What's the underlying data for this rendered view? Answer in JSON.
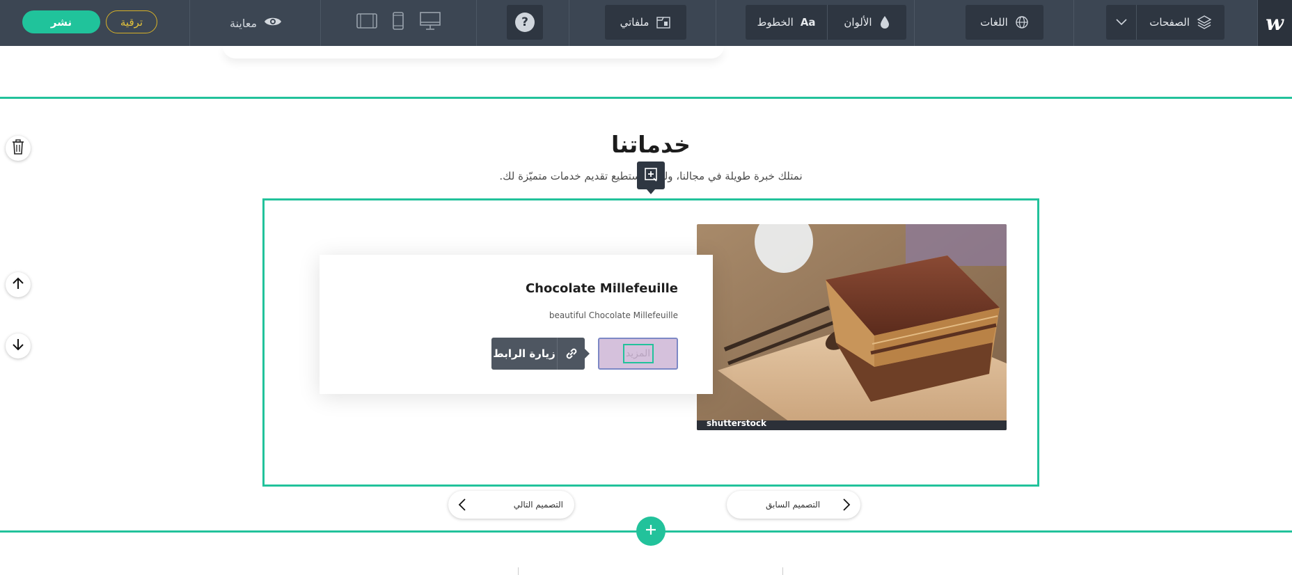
{
  "app": {
    "logo_text": "w",
    "pages_label": "الصفحات",
    "languages_label": "اللغات",
    "colors_label": "الألوان",
    "fonts_label": "الخطوط",
    "fonts_badge": "Aa",
    "files_label": "ملفاتي",
    "help_symbol": "?",
    "preview_label": "معاينة",
    "upgrade_label": "ترقية",
    "publish_label": "نشر"
  },
  "section": {
    "title": "خدماتنا",
    "subtitle": "نمتلك خبرة طويلة في مجالنا، ولذلك نستطيع تقديم خدمات متميّزة لك."
  },
  "card": {
    "title": "Chocolate Millefeuille",
    "description": "beautiful Chocolate Millefeuille",
    "more_label": "المزيد",
    "visit_link_label": "زيارة الرابط",
    "image_watermark": "shutterstock"
  },
  "design_nav": {
    "previous_label": "التصميم السابق",
    "next_label": "التصميم التالي"
  },
  "colors": {
    "topbar": "#3c4653",
    "accent": "#22c29b",
    "upgrade": "#d8b227"
  }
}
